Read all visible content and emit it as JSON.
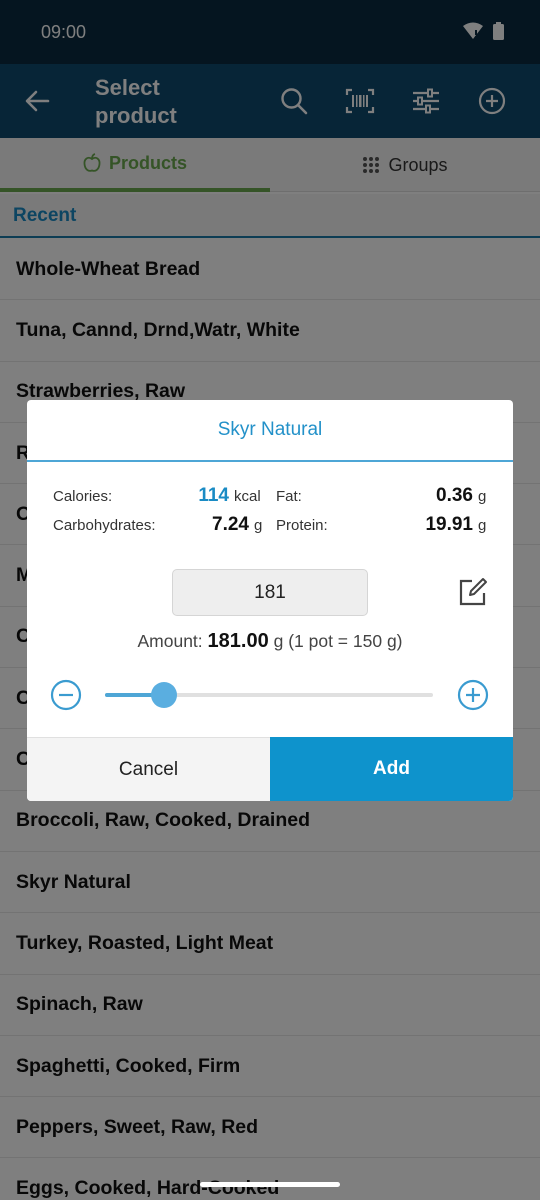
{
  "status": {
    "time": "09:00",
    "wifi_icon": "wifi-icon",
    "battery_icon": "battery-icon"
  },
  "appbar": {
    "title": "Select product",
    "back_icon": "arrow-back-icon",
    "actions": [
      "search-icon",
      "barcode-icon",
      "sliders-icon",
      "add-circle-icon"
    ],
    "background": "#0e4a6e"
  },
  "tabs": [
    {
      "label": "Products",
      "icon": "apple-icon",
      "active": true
    },
    {
      "label": "Groups",
      "icon": "grid-dots-icon",
      "active": false
    }
  ],
  "section": {
    "label": "Recent"
  },
  "list": {
    "items": [
      "Whole-Wheat Bread",
      "Tuna, Cannd, Drnd,Watr, White",
      "Strawberries, Raw",
      "R",
      "O",
      "M",
      "C",
      "C",
      "C",
      "Broccoli, Raw, Cooked, Drained",
      "Skyr Natural",
      "Turkey, Roasted, Light Meat",
      "Spinach, Raw",
      "Spaghetti, Cooked, Firm",
      "Peppers, Sweet, Raw, Red",
      "Eggs, Cooked, Hard-Cooked"
    ]
  },
  "dialog": {
    "title": "Skyr Natural",
    "calories_label": "Calories:",
    "calories_value": "114",
    "calories_unit": "kcal",
    "fat_label": "Fat:",
    "fat_value": "0.36",
    "fat_unit": "g",
    "carbs_label": "Carbohydrates:",
    "carbs_value": "7.24",
    "carbs_unit": "g",
    "protein_label": "Protein:",
    "protein_value": "19.91",
    "protein_unit": "g",
    "amount_input_value": "181",
    "amount_prefix": "Amount:",
    "amount_value": "181.00",
    "amount_suffix": "g (1 pot = 150 g)",
    "slider_level": 0.18,
    "cancel_label": "Cancel",
    "add_label": "Add",
    "accent_color": "#0e93cc"
  }
}
